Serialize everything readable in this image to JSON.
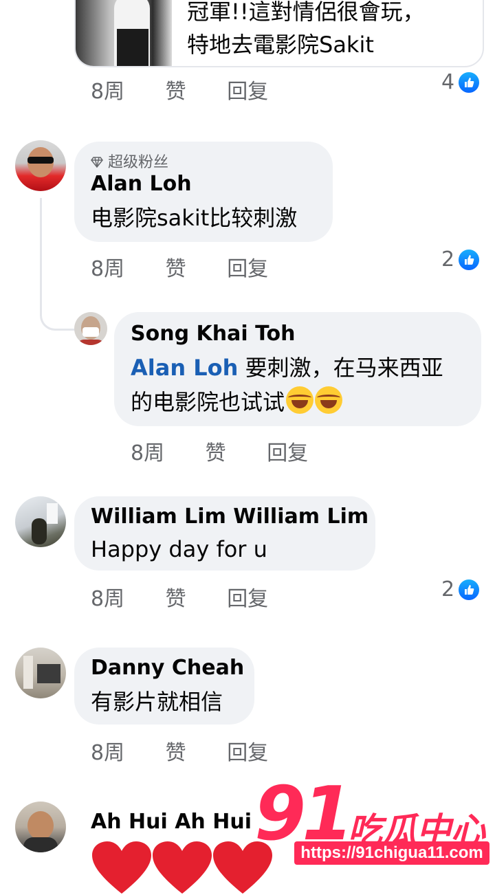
{
  "top_comment": {
    "link_text_line1": "冠軍!!這對情侶很會玩，",
    "link_text_line2": "特地去電影院Sakit",
    "time": "8周",
    "like": "赞",
    "reply": "回复",
    "reaction_count": "4"
  },
  "comments": [
    {
      "badge": "超级粉丝",
      "name": "Alan Loh",
      "text": "电影院sakit比较刺激",
      "time": "8周",
      "like": "赞",
      "reply": "回复",
      "reaction_count": "2"
    },
    {
      "name": "Song Khai Toh",
      "mention": "Alan Loh",
      "text_line1": " 要刺激，在马来西亚",
      "text_line2": "的电影院也试试",
      "time": "8周",
      "like": "赞",
      "reply": "回复"
    },
    {
      "name": "William Lim William Lim",
      "text": "Happy day for u",
      "time": "8周",
      "like": "赞",
      "reply": "回复",
      "reaction_count": "2"
    },
    {
      "name": "Danny Cheah",
      "text": "有影片就相信",
      "time": "8周",
      "like": "赞",
      "reply": "回复"
    },
    {
      "name": "Ah Hui Ah Hui"
    }
  ],
  "watermark": {
    "number": "91",
    "brand": "吃瓜中心",
    "url": "https://91chigua11.com"
  },
  "colors": {
    "bubble": "#f0f2f5",
    "link_blue": "#1a5fb4",
    "like_blue": "#0866ff",
    "heart_red": "#e4202f",
    "watermark_pink": "#ff2a57"
  }
}
